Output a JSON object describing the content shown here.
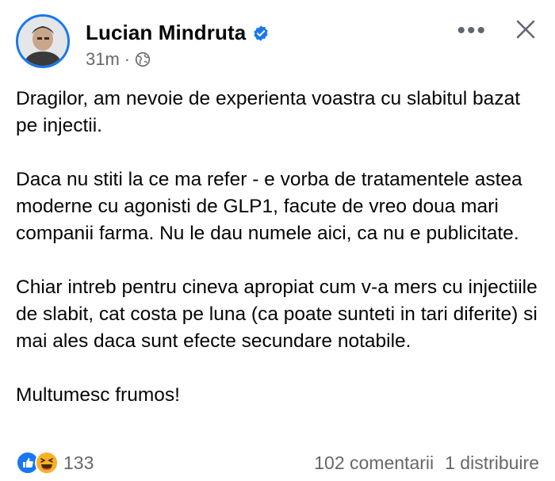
{
  "post": {
    "author": "Lucian Mindruta",
    "time": "31m",
    "separator": "·",
    "more_label": "•••",
    "paragraphs": [
      "Dragilor, am nevoie de experienta voastra cu slabitul bazat pe injectii.",
      "Daca nu stiti la ce ma refer - e vorba de tratamentele astea moderne cu agonisti de GLP1, facute de vreo doua mari companii farma. Nu le dau numele aici, ca nu e publicitate.",
      "Chiar intreb pentru cineva apropiat cum v-a mers cu injectiile de slabit, cat costa pe luna (ca poate sunteti in tari diferite) si mai ales daca sunt efecte secundare notabile.",
      "Multumesc frumos!"
    ]
  },
  "footer": {
    "reaction_count": "133",
    "comments": "102 comentarii",
    "shares": "1 distribuire"
  },
  "icons": {
    "verified": "verified-badge-icon",
    "privacy": "globe-icon",
    "like": "like-reaction-icon",
    "haha": "haha-reaction-icon",
    "close": "close-icon",
    "more": "more-options-icon"
  },
  "colors": {
    "brand_blue": "#1877f2",
    "secondary_text": "#65676b",
    "haha_yellow": "#f7b125"
  }
}
